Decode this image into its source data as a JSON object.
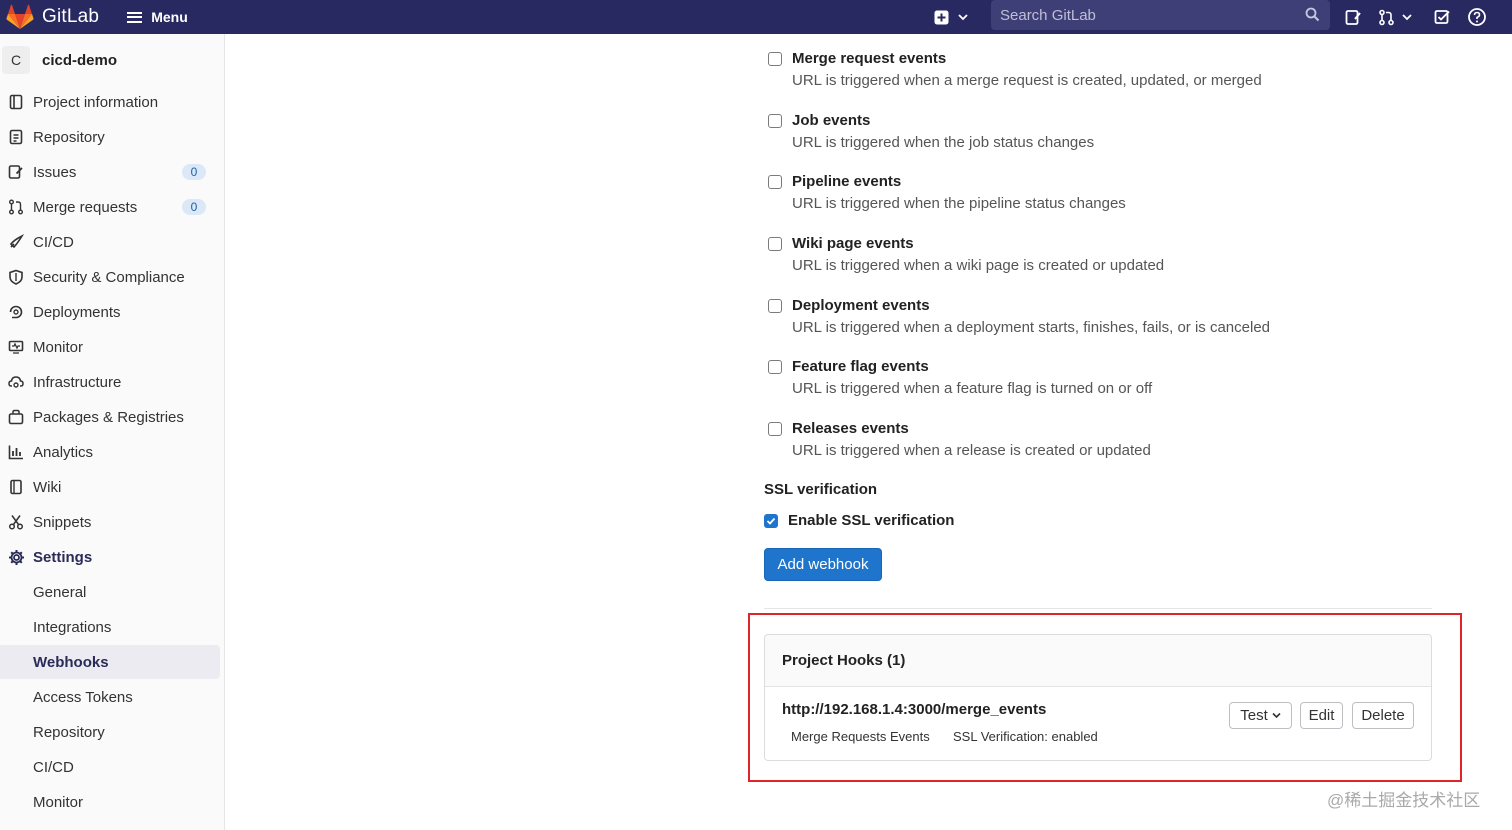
{
  "app": {
    "name": "GitLab",
    "menu_label": "Menu"
  },
  "search": {
    "placeholder": "Search GitLab"
  },
  "project": {
    "avatar_letter": "C",
    "name": "cicd-demo"
  },
  "sidebar": {
    "items": [
      {
        "label": "Project information",
        "icon": "info-icon"
      },
      {
        "label": "Repository",
        "icon": "doc-icon"
      },
      {
        "label": "Issues",
        "icon": "issues-icon",
        "badge": "0"
      },
      {
        "label": "Merge requests",
        "icon": "merge-request-icon",
        "badge": "0"
      },
      {
        "label": "CI/CD",
        "icon": "rocket-icon"
      },
      {
        "label": "Security & Compliance",
        "icon": "shield-icon"
      },
      {
        "label": "Deployments",
        "icon": "deployments-icon"
      },
      {
        "label": "Monitor",
        "icon": "monitor-icon"
      },
      {
        "label": "Infrastructure",
        "icon": "cloud-gear-icon"
      },
      {
        "label": "Packages & Registries",
        "icon": "package-icon"
      },
      {
        "label": "Analytics",
        "icon": "chart-icon"
      },
      {
        "label": "Wiki",
        "icon": "book-icon"
      },
      {
        "label": "Snippets",
        "icon": "scissors-icon"
      },
      {
        "label": "Settings",
        "icon": "gear-icon"
      }
    ],
    "settings_sub": [
      "General",
      "Integrations",
      "Webhooks",
      "Access Tokens",
      "Repository",
      "CI/CD",
      "Monitor"
    ],
    "active_sub": "Webhooks"
  },
  "events": [
    {
      "title": "Merge request events",
      "desc": "URL is triggered when a merge request is created, updated, or merged",
      "checked": false
    },
    {
      "title": "Job events",
      "desc": "URL is triggered when the job status changes",
      "checked": false
    },
    {
      "title": "Pipeline events",
      "desc": "URL is triggered when the pipeline status changes",
      "checked": false
    },
    {
      "title": "Wiki page events",
      "desc": "URL is triggered when a wiki page is created or updated",
      "checked": false
    },
    {
      "title": "Deployment events",
      "desc": "URL is triggered when a deployment starts, finishes, fails, or is canceled",
      "checked": false
    },
    {
      "title": "Feature flag events",
      "desc": "URL is triggered when a feature flag is turned on or off",
      "checked": false
    },
    {
      "title": "Releases events",
      "desc": "URL is triggered when a release is created or updated",
      "checked": false
    }
  ],
  "ssl": {
    "title": "SSL verification",
    "label": "Enable SSL verification",
    "checked": true
  },
  "add_button": "Add webhook",
  "hooks": {
    "title": "Project Hooks (1)",
    "items": [
      {
        "url": "http://192.168.1.4:3000/merge_events",
        "tags": [
          "Merge Requests Events",
          "SSL Verification: enabled"
        ],
        "test_label": "Test",
        "edit_label": "Edit",
        "delete_label": "Delete"
      }
    ]
  },
  "watermark": "@稀土掘金技术社区",
  "colors": {
    "topbar": "#292961",
    "primary": "#1f75cb",
    "highlight": "#e0242a"
  }
}
